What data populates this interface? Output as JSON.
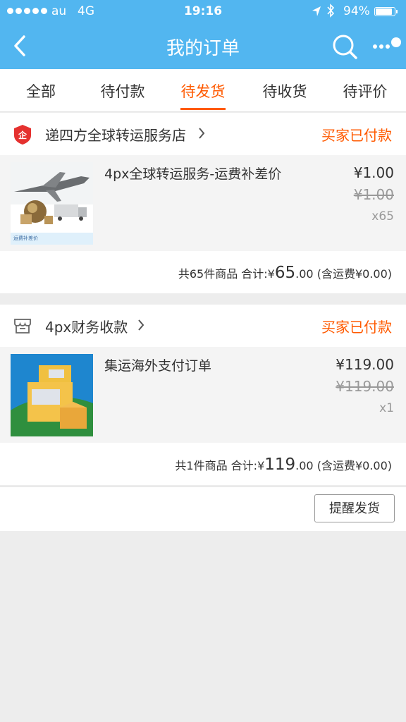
{
  "status_bar": {
    "carrier": "au",
    "network": "4G",
    "time": "19:16",
    "battery": "94%",
    "battery_level": 0.94
  },
  "nav": {
    "title": "我的订单"
  },
  "tabs": [
    {
      "label": "全部"
    },
    {
      "label": "待付款"
    },
    {
      "label": "待发货"
    },
    {
      "label": "待收货"
    },
    {
      "label": "待评价"
    }
  ],
  "active_tab": "待发货",
  "orders": [
    {
      "shop_name": "递四方全球转运服务店",
      "status": "买家已付款",
      "product_name": "4px全球转运服务-运费补差价",
      "price": "¥1.00",
      "original_price": "¥1.00",
      "quantity": "x65",
      "thumb_caption": "运费补差价",
      "summary_prefix": "共65件商品 合计:¥",
      "total_big": "65",
      "total_small": ".00",
      "shipping": " (含运费¥0.00)"
    },
    {
      "shop_name": "4px财务收款",
      "status": "买家已付款",
      "product_name": "集运海外支付订单",
      "price": "¥119.00",
      "original_price": "¥119.00",
      "quantity": "x1",
      "summary_prefix": "共1件商品 合计:¥",
      "total_big": "119",
      "total_small": ".00",
      "shipping": " (含运费¥0.00)",
      "action_button": "提醒发货"
    }
  ],
  "colors": {
    "header_blue": "#52b6f0",
    "accent_orange": "#ff5a00"
  }
}
